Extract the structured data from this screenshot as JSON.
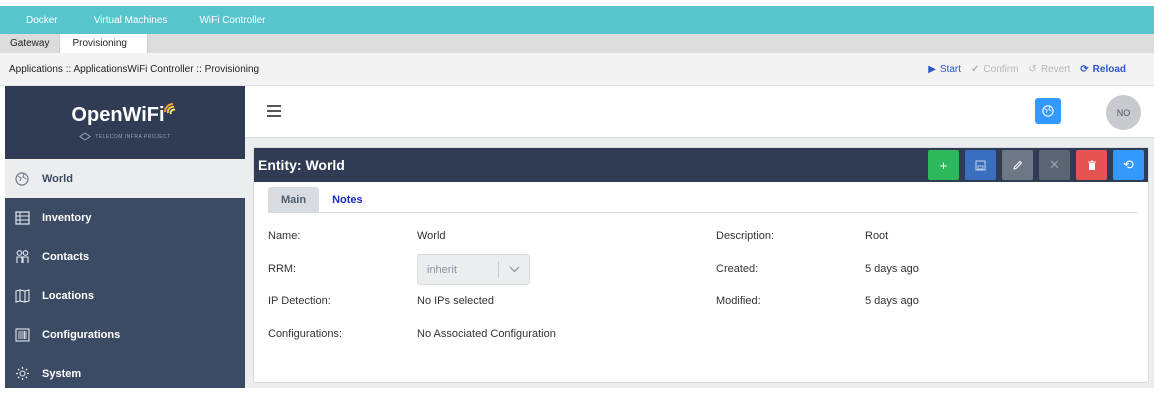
{
  "top_tabs": [
    "Docker",
    "Virtual Machines",
    "WiFi Controller"
  ],
  "sub_tabs": [
    "Gateway",
    "Provisioning"
  ],
  "breadcrumb": "Applications :: ApplicationsWiFi Controller :: Provisioning",
  "actions": {
    "start": "Start",
    "confirm": "Confirm",
    "revert": "Revert",
    "reload": "Reload"
  },
  "brand": {
    "name": "OpenWiFi",
    "sub": "TELECOM INFRA PROJECT"
  },
  "sidebar": {
    "items": [
      {
        "label": "World",
        "icon": "globe-icon"
      },
      {
        "label": "Inventory",
        "icon": "list-icon"
      },
      {
        "label": "Contacts",
        "icon": "people-icon"
      },
      {
        "label": "Locations",
        "icon": "map-icon"
      },
      {
        "label": "Configurations",
        "icon": "barcode-icon"
      },
      {
        "label": "System",
        "icon": "gear-icon"
      }
    ]
  },
  "header": {
    "avatar": "NO"
  },
  "entity": {
    "title": "Entity: World",
    "tabs": [
      "Main",
      "Notes"
    ],
    "fields": {
      "name_label": "Name:",
      "name_value": "World",
      "rrm_label": "RRM:",
      "rrm_value": "inherit",
      "ip_label": "IP Detection:",
      "ip_value": "No IPs selected",
      "config_label": "Configurations:",
      "config_value": "No Associated Configuration",
      "desc_label": "Description:",
      "desc_value": "Root",
      "created_label": "Created:",
      "created_value": "5 days ago",
      "modified_label": "Modified:",
      "modified_value": "5 days ago"
    }
  },
  "colors": {
    "teal": "#58c4cc",
    "sidebar": "#3c4b64",
    "primary": "#3399ff",
    "success": "#2eb85c",
    "danger": "#e55353"
  }
}
